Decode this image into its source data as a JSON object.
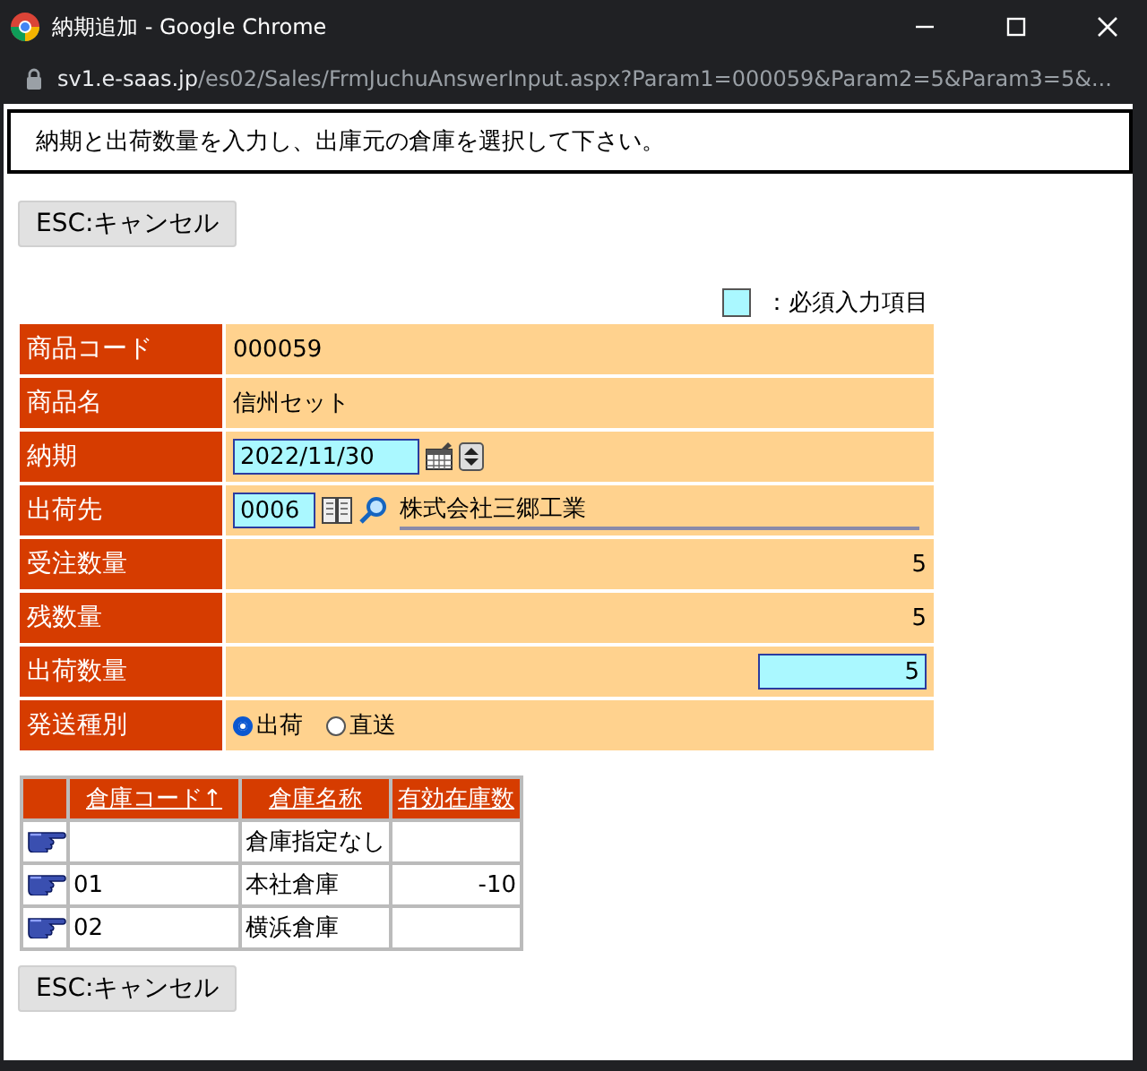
{
  "window": {
    "title": "納期追加 - Google Chrome",
    "url_host": "sv1.e-saas.jp",
    "url_path": "/es02/Sales/FrmJuchuAnswerInput.aspx?Param1=000059&Param2=5&Param3=5&..."
  },
  "message": "納期と出荷数量を入力し、出庫元の倉庫を選択して下さい。",
  "cancel_button_top": "ESC:キャンセル",
  "legend": "：必須入力項目",
  "form": [
    {
      "kind": "text",
      "label": "商品コード",
      "value": "000059"
    },
    {
      "kind": "text",
      "label": "商品名",
      "value": "信州セット"
    },
    {
      "kind": "date",
      "label": "納期",
      "value": "2022/11/30"
    },
    {
      "kind": "customer",
      "label": "出荷先",
      "value": "0006",
      "name": "株式会社三郷工業"
    },
    {
      "kind": "number",
      "label": "受注数量",
      "value": "5"
    },
    {
      "kind": "number",
      "label": "残数量",
      "value": "5"
    },
    {
      "kind": "input",
      "label": "出荷数量",
      "value": "5"
    },
    {
      "kind": "radio",
      "label": "発送種別",
      "options": [
        {
          "label": "出荷",
          "selected": true
        },
        {
          "label": "直送",
          "selected": false
        }
      ]
    }
  ],
  "warehouses": {
    "columns": [
      "倉庫コード↑",
      "倉庫名称",
      "有効在庫数"
    ],
    "rows": [
      {
        "code": "",
        "name": "倉庫指定なし",
        "stock": ""
      },
      {
        "code": "01",
        "name": "本社倉庫",
        "stock": "-10"
      },
      {
        "code": "02",
        "name": "横浜倉庫",
        "stock": ""
      }
    ]
  },
  "cancel_button_bottom": "ESC:キャンセル"
}
